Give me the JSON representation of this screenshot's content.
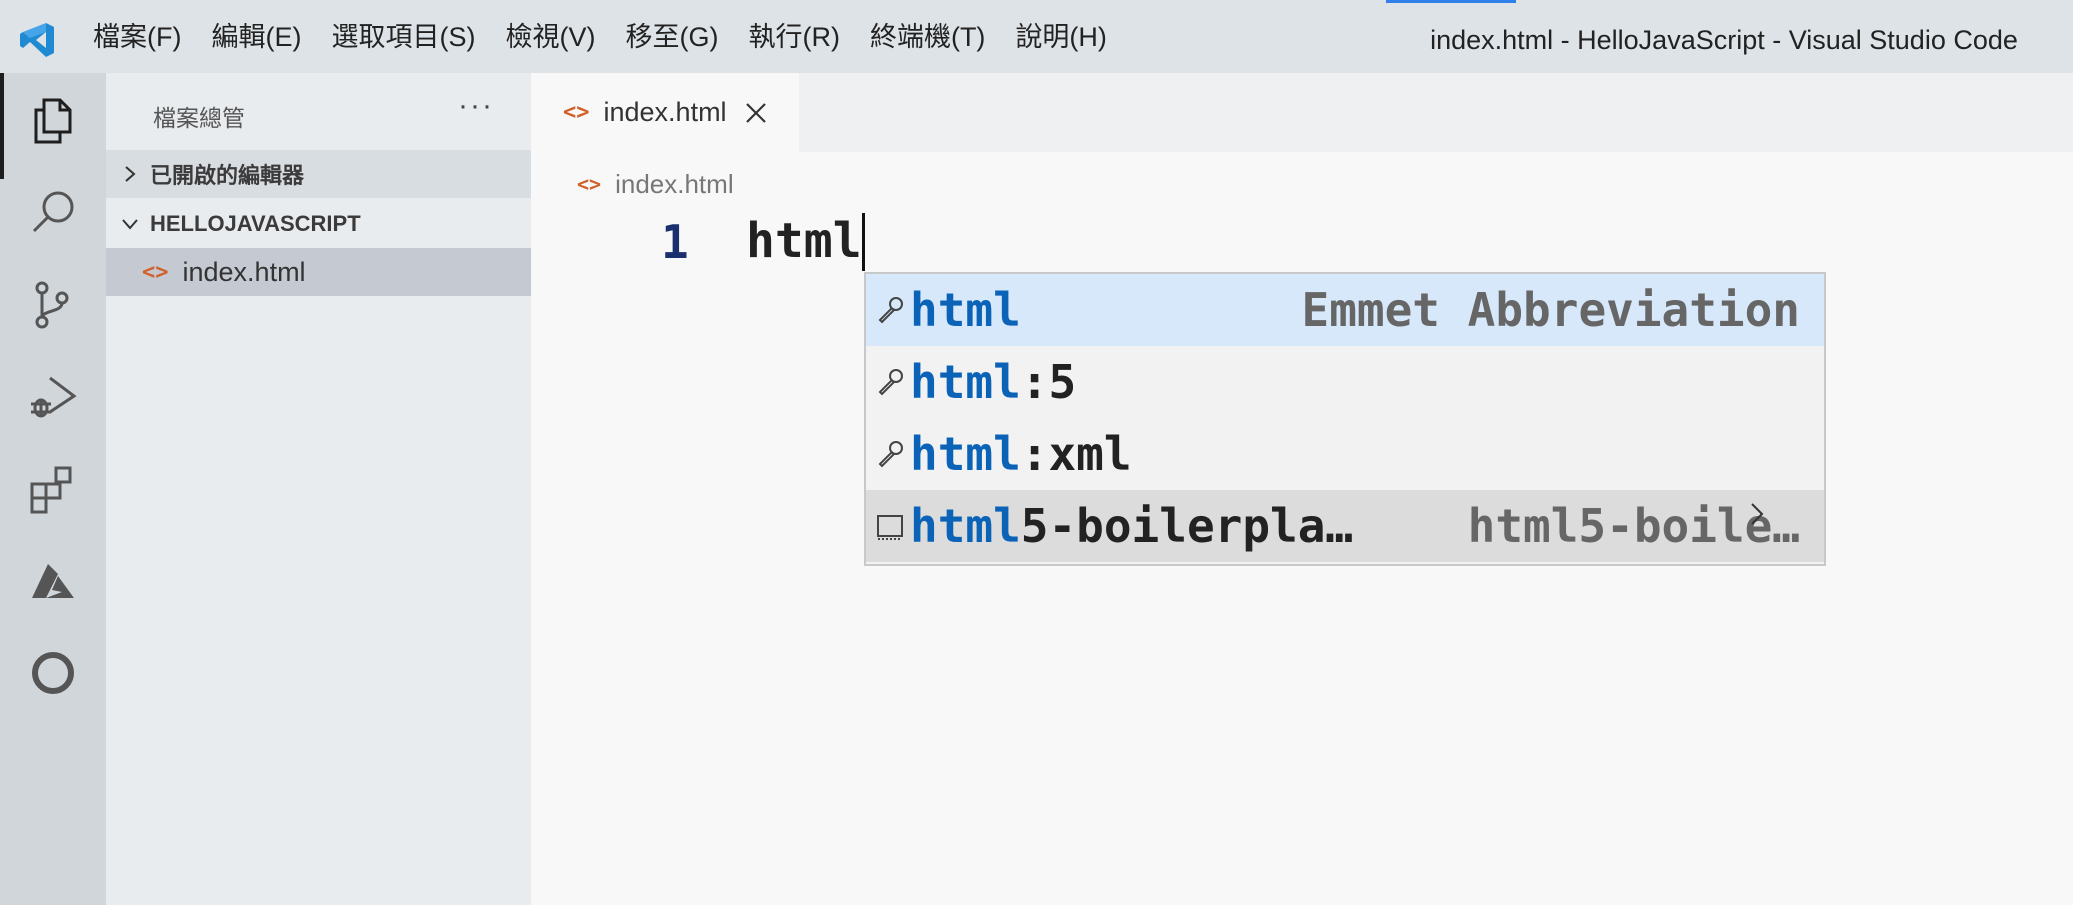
{
  "app": {
    "logo_icon": "vscode-logo-icon",
    "accent_color": "#2f80e8",
    "window_title": "index.html - HelloJavaScript - Visual Studio Code"
  },
  "menubar": {
    "items": [
      {
        "label": "檔案(F)"
      },
      {
        "label": "編輯(E)"
      },
      {
        "label": "選取項目(S)"
      },
      {
        "label": "檢視(V)"
      },
      {
        "label": "移至(G)"
      },
      {
        "label": "執行(R)"
      },
      {
        "label": "終端機(T)"
      },
      {
        "label": "說明(H)"
      }
    ]
  },
  "activitybar": {
    "items": [
      {
        "name": "explorer",
        "icon": "files-icon",
        "active": true
      },
      {
        "name": "search",
        "icon": "search-icon"
      },
      {
        "name": "source-control",
        "icon": "source-control-icon"
      },
      {
        "name": "run-debug",
        "icon": "run-debug-icon"
      },
      {
        "name": "extensions",
        "icon": "extensions-icon"
      },
      {
        "name": "azure",
        "icon": "azure-icon"
      },
      {
        "name": "remote",
        "icon": "circle-icon"
      }
    ]
  },
  "sidebar": {
    "title": "檔案總管",
    "more_label": "···",
    "sections": [
      {
        "label": "已開啟的編輯器",
        "expanded": false
      },
      {
        "label": "HELLOJAVASCRIPT",
        "expanded": true
      }
    ],
    "files": [
      {
        "name": "index.html",
        "icon": "html-file-icon",
        "selected": true
      }
    ]
  },
  "editor": {
    "tabs": [
      {
        "label": "index.html",
        "icon": "html-file-icon",
        "active": true
      }
    ],
    "breadcrumb": [
      "index.html"
    ],
    "lines": [
      {
        "number": "1",
        "text": "html"
      }
    ],
    "suggestions": [
      {
        "match": "html",
        "rest": "",
        "detail": "Emmet Abbreviation",
        "icon": "wrench-icon",
        "selected": true
      },
      {
        "match": "html",
        "rest": ":5",
        "detail": "",
        "icon": "wrench-icon"
      },
      {
        "match": "html",
        "rest": ":xml",
        "detail": "",
        "icon": "wrench-icon"
      },
      {
        "match": "html",
        "rest": "5-boilerpla…",
        "detail": "html5-boile…",
        "icon": "snippet-icon",
        "focused": true
      }
    ]
  }
}
